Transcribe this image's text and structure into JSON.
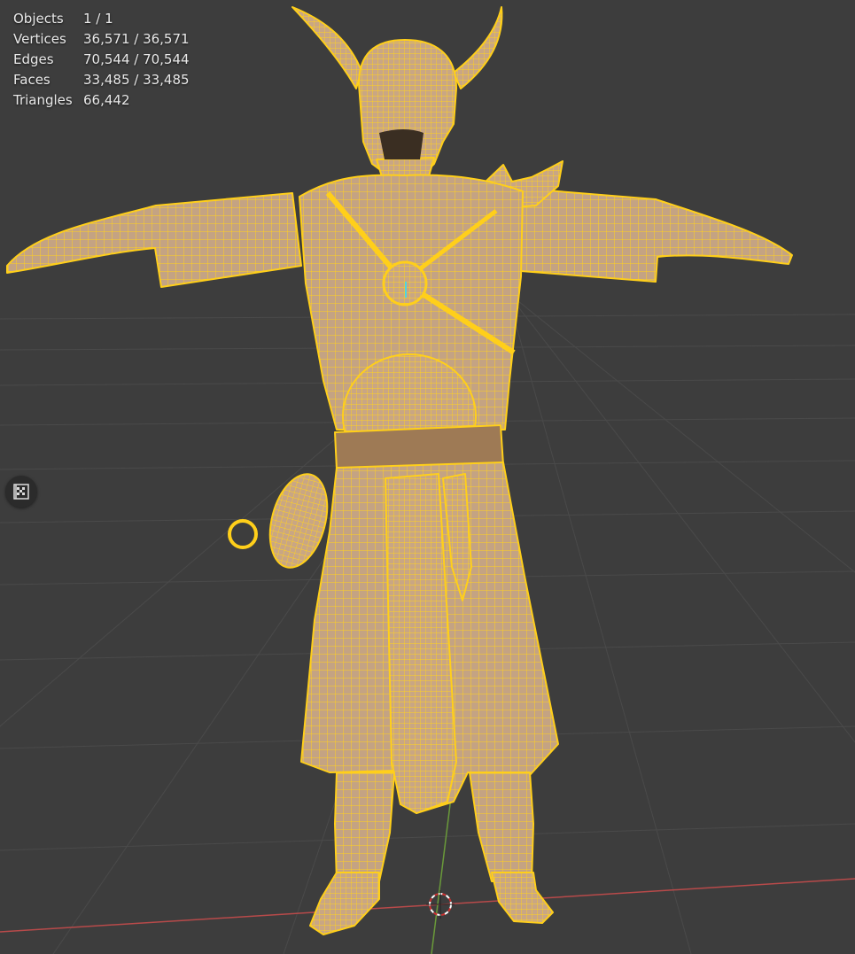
{
  "stats": [
    {
      "label": "Objects",
      "value": "1 / 1"
    },
    {
      "label": "Vertices",
      "value": "36,571 / 36,571"
    },
    {
      "label": "Edges",
      "value": "70,544 / 70,544"
    },
    {
      "label": "Faces",
      "value": "33,485 / 33,485"
    },
    {
      "label": "Triangles",
      "value": "66,442"
    }
  ],
  "icons": {
    "toggle": "camera-perspective-toggle-icon",
    "cursor": "3d-cursor-icon"
  },
  "colors": {
    "background": "#3d3d3d",
    "grid": "#4a4a4a",
    "x_axis": "#b84a4a",
    "y_axis": "#6a9a3a",
    "wire": "#ffcf1a",
    "mesh_fill": "#c4a383"
  }
}
